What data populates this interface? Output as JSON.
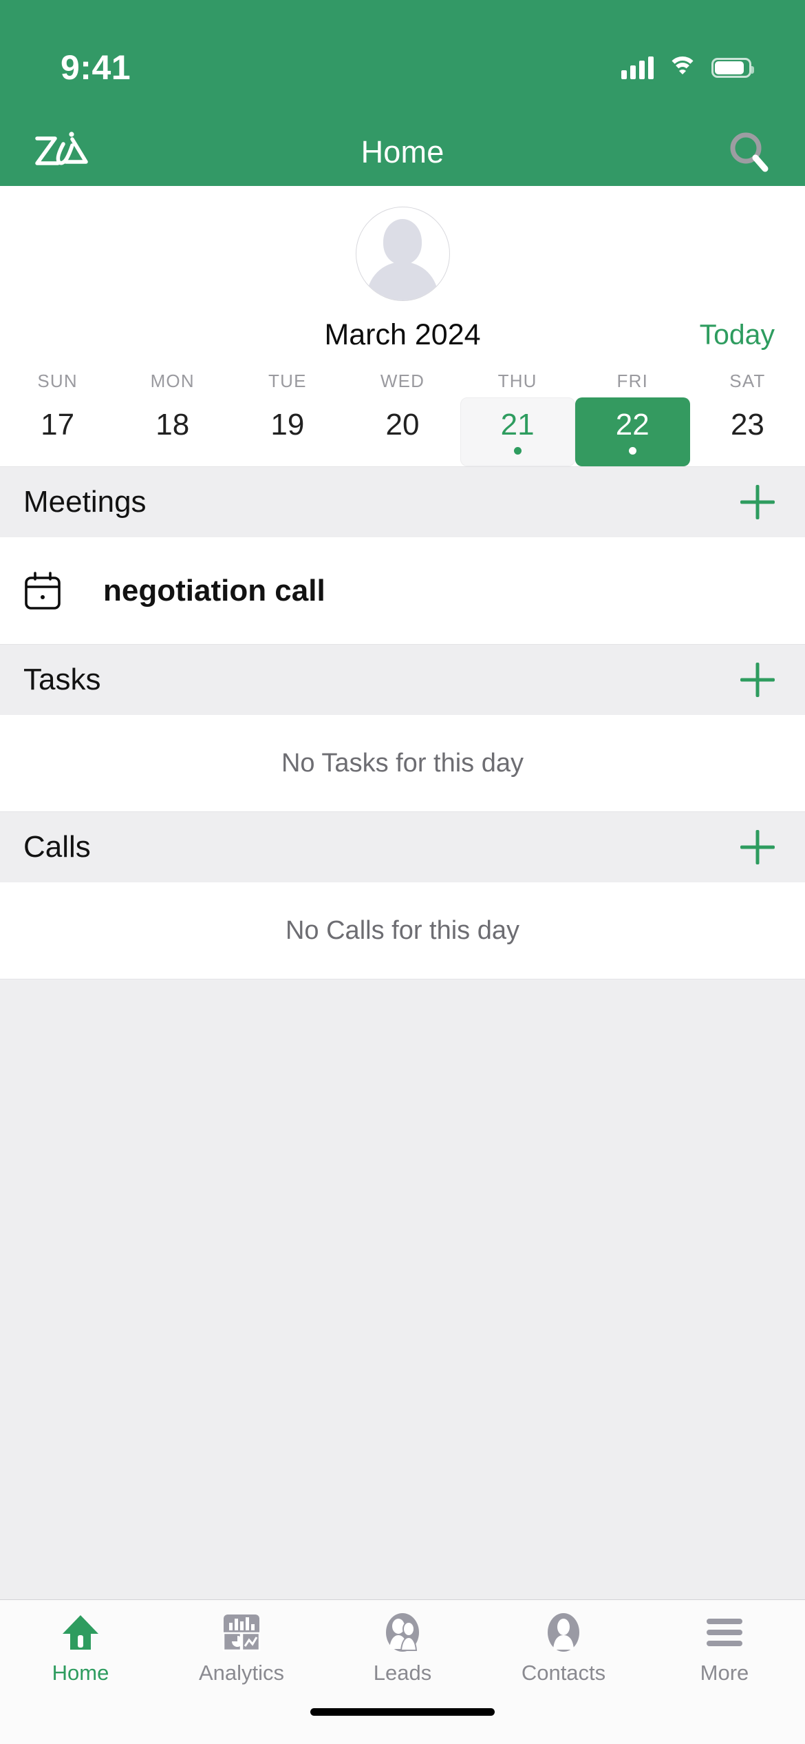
{
  "status_bar": {
    "time": "9:41",
    "cellular_icon": "signal-bars-icon",
    "wifi_icon": "wifi-icon",
    "battery_icon": "battery-icon"
  },
  "nav_bar": {
    "logo_icon": "zia-logo-icon",
    "logo_label": "Zia",
    "title": "Home",
    "search_icon": "search-icon"
  },
  "profile": {
    "avatar_icon": "user-avatar-placeholder-icon"
  },
  "calendar": {
    "month_label": "March 2024",
    "today_label": "Today",
    "weekdays": [
      "SUN",
      "MON",
      "TUE",
      "WED",
      "THU",
      "FRI",
      "SAT"
    ],
    "dates": [
      {
        "day": "17",
        "state": "normal"
      },
      {
        "day": "18",
        "state": "normal"
      },
      {
        "day": "19",
        "state": "normal"
      },
      {
        "day": "20",
        "state": "normal"
      },
      {
        "day": "21",
        "state": "today"
      },
      {
        "day": "22",
        "state": "selected"
      },
      {
        "day": "23",
        "state": "normal"
      }
    ]
  },
  "sections": {
    "meetings": {
      "title": "Meetings",
      "add_icon": "plus-icon",
      "items": [
        {
          "icon": "calendar-icon",
          "title": "negotiation call"
        }
      ]
    },
    "tasks": {
      "title": "Tasks",
      "add_icon": "plus-icon",
      "empty_text": "No Tasks for this day"
    },
    "calls": {
      "title": "Calls",
      "add_icon": "plus-icon",
      "empty_text": "No Calls for this day"
    }
  },
  "tab_bar": {
    "items": [
      {
        "label": "Home",
        "icon": "home-icon",
        "active": true
      },
      {
        "label": "Analytics",
        "icon": "analytics-icon",
        "active": false
      },
      {
        "label": "Leads",
        "icon": "leads-icon",
        "active": false
      },
      {
        "label": "Contacts",
        "icon": "contacts-icon",
        "active": false
      },
      {
        "label": "More",
        "icon": "hamburger-menu-icon",
        "active": false
      }
    ]
  },
  "colors": {
    "brand_green": "#339966",
    "accent_green": "#2e9c5f",
    "section_bg": "#eeeef0",
    "muted_text": "#6d6d72"
  }
}
